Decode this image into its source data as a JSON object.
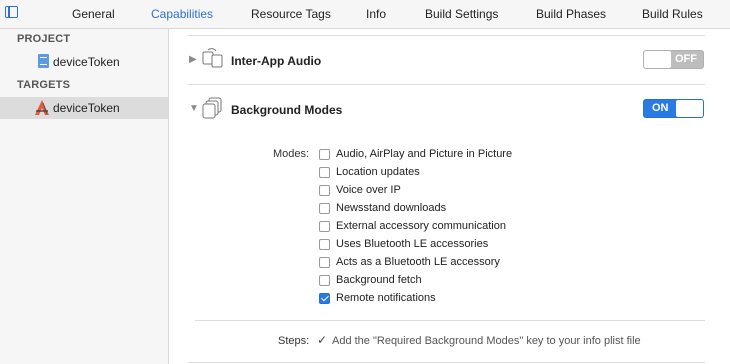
{
  "tabs": [
    {
      "label": "General",
      "active": false
    },
    {
      "label": "Capabilities",
      "active": true
    },
    {
      "label": "Resource Tags",
      "active": false
    },
    {
      "label": "Info",
      "active": false
    },
    {
      "label": "Build Settings",
      "active": false
    },
    {
      "label": "Build Phases",
      "active": false
    },
    {
      "label": "Build Rules",
      "active": false
    }
  ],
  "sidebar": {
    "project_header": "PROJECT",
    "project_item": "deviceToken",
    "targets_header": "TARGETS",
    "target_item": "deviceToken"
  },
  "capabilities": {
    "inter_app_audio": {
      "title": "Inter-App Audio",
      "toggle": "OFF"
    },
    "background_modes": {
      "title": "Background Modes",
      "toggle": "ON"
    }
  },
  "modes": {
    "label": "Modes:",
    "items": [
      {
        "label": "Audio, AirPlay and Picture in Picture",
        "checked": false
      },
      {
        "label": "Location updates",
        "checked": false
      },
      {
        "label": "Voice over IP",
        "checked": false
      },
      {
        "label": "Newsstand downloads",
        "checked": false
      },
      {
        "label": "External accessory communication",
        "checked": false
      },
      {
        "label": "Uses Bluetooth LE accessories",
        "checked": false
      },
      {
        "label": "Acts as a Bluetooth LE accessory",
        "checked": false
      },
      {
        "label": "Background fetch",
        "checked": false
      },
      {
        "label": "Remote notifications",
        "checked": true
      }
    ]
  },
  "steps": {
    "label": "Steps:",
    "check": "✓",
    "text": "Add the \"Required Background Modes\" key to your info plist file"
  },
  "colors": {
    "accent": "#2a7ae4",
    "sidebar_bg": "#f6f6f6"
  },
  "icons": [
    "sidebar-toggle-icon",
    "document-icon",
    "app-target-icon",
    "audio-capability-icon",
    "background-modes-icon",
    "disclosure-triangle-icon",
    "checkmark-icon"
  ]
}
